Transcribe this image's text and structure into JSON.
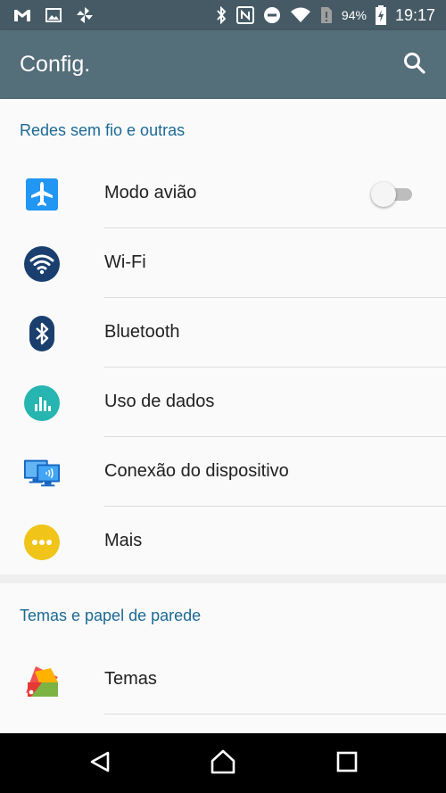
{
  "status_bar": {
    "left_icons": [
      "gmail-icon",
      "image-icon",
      "pinwheel-icon"
    ],
    "right_icons": [
      "bluetooth-icon",
      "nfc-icon",
      "do-not-disturb-icon",
      "wifi-icon",
      "sim-alert-icon"
    ],
    "battery": "94%",
    "time": "19:17"
  },
  "app_bar": {
    "title": "Config.",
    "search_icon": "search-icon"
  },
  "sections": [
    {
      "header": "Redes sem fio e outras",
      "items": [
        {
          "label": "Modo avião",
          "icon": "airplane-icon",
          "icon_color": "#2196f3",
          "toggle": false
        },
        {
          "label": "Wi-Fi",
          "icon": "wifi-icon",
          "icon_color": "#1a3f6e"
        },
        {
          "label": "Bluetooth",
          "icon": "bluetooth-icon",
          "icon_color": "#1a3f6e"
        },
        {
          "label": "Uso de dados",
          "icon": "data-usage-icon",
          "icon_color": "#26b5b0"
        },
        {
          "label": "Conexão do dispositivo",
          "icon": "device-connection-icon",
          "icon_color": "#1e88e5"
        },
        {
          "label": "Mais",
          "icon": "more-icon",
          "icon_color": "#f0c419"
        }
      ]
    },
    {
      "header": "Temas e papel de parede",
      "items": [
        {
          "label": "Temas",
          "icon": "themes-icon"
        }
      ]
    }
  ],
  "nav_bar": {
    "back": "back-icon",
    "home": "home-icon",
    "recents": "recents-icon"
  },
  "colors": {
    "status_bar": "#455a64",
    "app_bar": "#546e7a",
    "section_header": "#1b6a94",
    "background": "#fafafa"
  }
}
